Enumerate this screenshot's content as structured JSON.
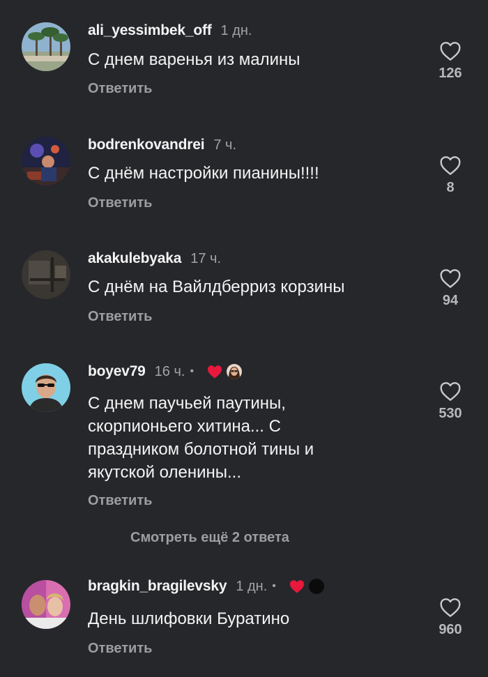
{
  "comments": [
    {
      "username": "ali_yessimbek_off",
      "time": "1 дн.",
      "text": "С днем варенья из малины",
      "reply": "Ответить",
      "likes": "126",
      "icons": {
        "avatar": "palm-trees-avatar",
        "like": "heart-outline-icon"
      }
    },
    {
      "username": "bodrenkovandrei",
      "time": "7 ч.",
      "text": "С днём настройки пианины!!!!",
      "reply": "Ответить",
      "likes": "8",
      "icons": {
        "avatar": "concert-avatar",
        "like": "heart-outline-icon"
      }
    },
    {
      "username": "akakulebyaka",
      "time": "17 ч.",
      "text": "С днём на Вайлдберриз корзины",
      "reply": "Ответить",
      "likes": "94",
      "icons": {
        "avatar": "dark-room-avatar",
        "like": "heart-outline-icon"
      }
    },
    {
      "username": "boyev79",
      "time": "16 ч.",
      "separator": "•",
      "text_lines": [
        "С днем паучьей паутины,",
        "скорпионьего хитина... С",
        "праздником болотной тины и",
        "якутской оленины..."
      ],
      "reply": "Ответить",
      "likes": "530",
      "icons": {
        "avatar": "man-sunglasses-avatar",
        "like": "heart-outline-icon",
        "author_reaction": "red-heart-icon"
      }
    },
    {
      "username": "bragkin_bragilevsky",
      "time": "1 дн.",
      "separator": "•",
      "text": "День шлифовки Буратино",
      "reply": "Ответить",
      "likes": "960",
      "icons": {
        "avatar": "couple-avatar",
        "like": "heart-outline-icon",
        "author_reaction": "red-heart-icon"
      }
    }
  ],
  "more_replies": "Смотреть ещё 2 ответа",
  "colors": {
    "background": "#26272b",
    "text": "#f4f4f4",
    "muted": "#9d9ea2",
    "reaction": "#e8193c"
  }
}
